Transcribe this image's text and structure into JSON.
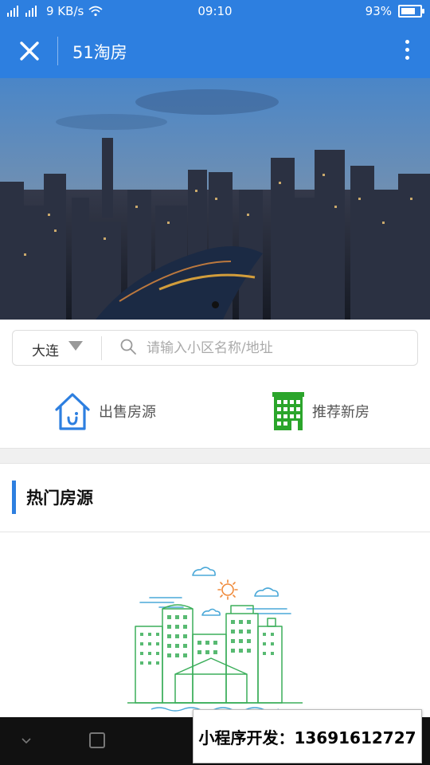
{
  "status_bar": {
    "network": "2G 4G",
    "speed": "9 KB/s",
    "time": "09:10",
    "battery": "93%",
    "battery_level": 0.93
  },
  "navbar": {
    "title": "51淘房",
    "close_icon": "close-icon",
    "more_icon": "more-vertical-icon"
  },
  "banner": {
    "image": "city-skyline-night",
    "slides": 1,
    "active_slide": 1
  },
  "search": {
    "city": "大连",
    "placeholder": "请输入小区名称/地址"
  },
  "quick_links": [
    {
      "label": "出售房源",
      "icon": "house-icon"
    },
    {
      "label": "推荐新房",
      "icon": "building-icon"
    }
  ],
  "section": {
    "title": "热门房源"
  },
  "promo": {
    "text": "小程序开发：13691612727"
  },
  "colors": {
    "brand": "#2d7fe0",
    "green": "#2ba52b"
  }
}
